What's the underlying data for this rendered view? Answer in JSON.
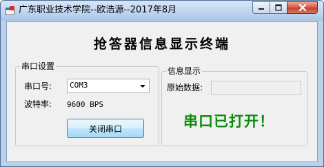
{
  "window": {
    "title": "广东职业技术学院--欧浩源--2017年8月",
    "controls": {
      "minimize_icon": "minimize-icon",
      "maximize_icon": "maximize-icon",
      "close_icon": "close-icon"
    }
  },
  "app": {
    "heading": "抢答器信息显示终端"
  },
  "serial_group": {
    "legend": "串口设置",
    "port_label": "串口号:",
    "port_value": "COM3",
    "baud_label": "波特率:",
    "baud_value": "9600 BPS",
    "close_button_label": "关闭串口"
  },
  "info_group": {
    "legend": "信息显示",
    "raw_label": "原始数据:",
    "raw_value": "",
    "status_text": "串口已打开！"
  },
  "colors": {
    "status_text": "#0a8a0a",
    "close_button": "#c7432d"
  }
}
